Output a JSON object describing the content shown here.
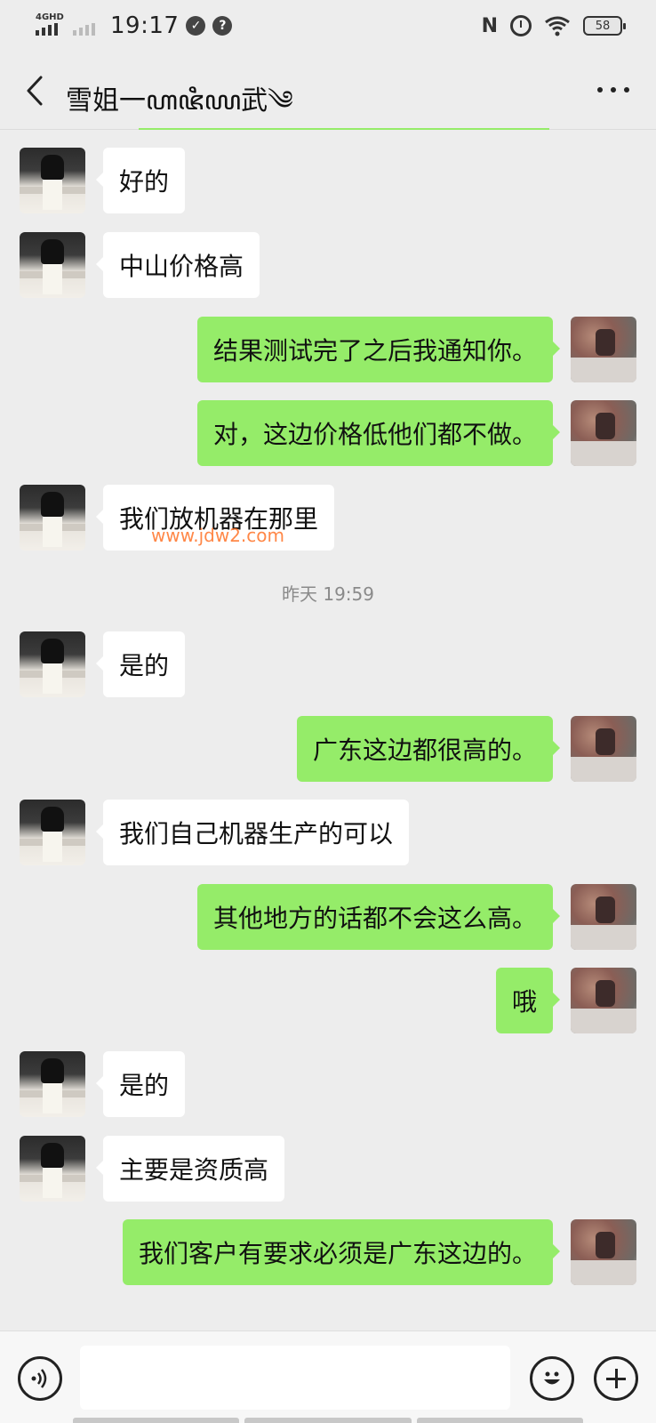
{
  "status_bar": {
    "network": "4GHD",
    "time": "19:17",
    "battery": "58"
  },
  "header": {
    "title": "雪姐一ꦲꦗꦶꦪ武༄"
  },
  "messages": [
    {
      "side": "left",
      "text": "好的"
    },
    {
      "side": "left",
      "text": "中山价格高"
    },
    {
      "side": "right",
      "text": "结果测试完了之后我通知你。"
    },
    {
      "side": "right",
      "text": "对，这边价格低他们都不做。"
    },
    {
      "side": "left",
      "text": "我们放机器在那里"
    },
    {
      "side": "left",
      "text": "是的"
    },
    {
      "side": "right",
      "text": "广东这边都很高的。"
    },
    {
      "side": "left",
      "text": "我们自己机器生产的可以"
    },
    {
      "side": "right",
      "text": "其他地方的话都不会这么高。"
    },
    {
      "side": "right",
      "text": "哦"
    },
    {
      "side": "left",
      "text": "是的"
    },
    {
      "side": "left",
      "text": "主要是资质高"
    },
    {
      "side": "right",
      "text": "我们客户有要求必须是广东这边的。"
    }
  ],
  "timestamp": "昨天 19:59",
  "watermark": "www.jdw2.com",
  "icons": {
    "back": "back-arrow-icon",
    "more": "more-dots-icon",
    "voice": "voice-icon",
    "emoji": "emoji-icon",
    "plus": "plus-icon"
  },
  "colors": {
    "sent_bubble": "#95ec69",
    "received_bubble": "#ffffff",
    "background": "#ededed"
  }
}
